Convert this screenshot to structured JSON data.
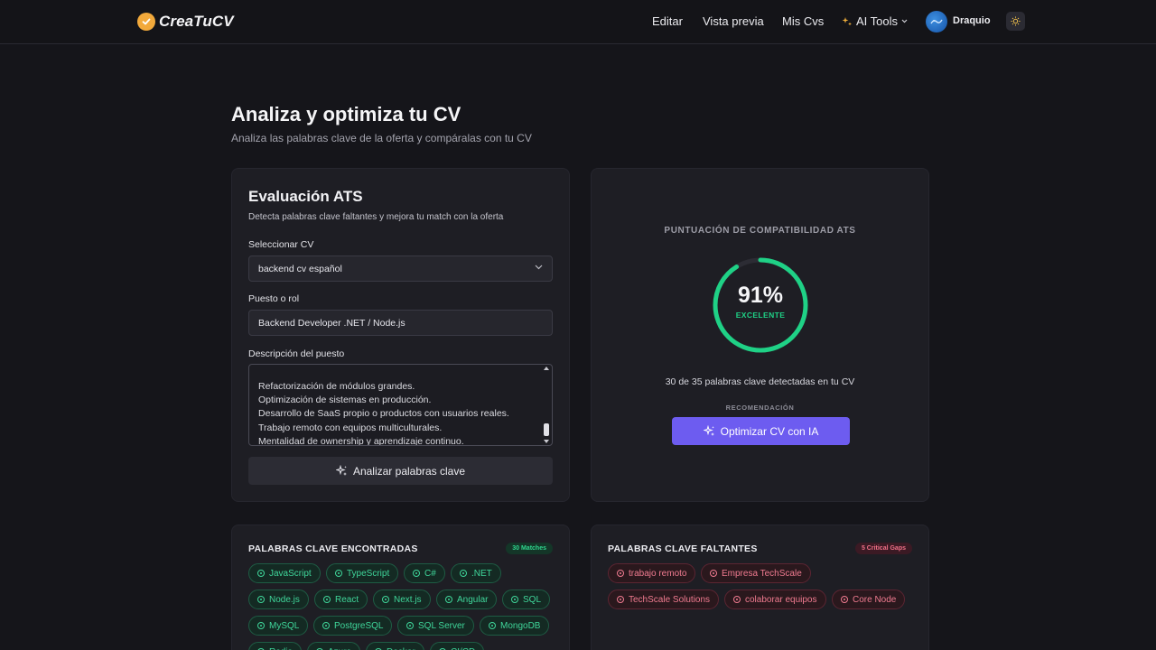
{
  "nav": {
    "logo": "CreaTuCV",
    "links": [
      "Editar",
      "Vista previa",
      "Mis Cvs"
    ],
    "ai_tools": "AI Tools",
    "user": "Draquio"
  },
  "header": {
    "title": "Analiza y optimiza tu CV",
    "subtitle": "Analiza las palabras clave de la oferta y compáralas con tu CV"
  },
  "evaluation": {
    "title": "Evaluación ATS",
    "subtitle": "Detecta palabras clave faltantes y mejora tu match con la oferta",
    "select_label": "Seleccionar CV",
    "select_value": "backend cv español",
    "role_label": "Puesto o rol",
    "role_value": "Backend Developer .NET / Node.js",
    "description_label": "Descripción del puesto",
    "description_lines": [
      "Refactorización de módulos grandes.",
      "Optimización de sistemas en producción.",
      "Desarrollo de SaaS propio o productos con usuarios reales.",
      "Trabajo remoto con equipos multiculturales.",
      "Mentalidad de ownership y aprendizaje continuo."
    ],
    "analyze_button": "Analizar palabras clave"
  },
  "score": {
    "heading": "PUNTUACIÓN DE COMPATIBILIDAD ATS",
    "value": "91%",
    "percent": 91,
    "label": "EXCELENTE",
    "detected": "30 de 35 palabras clave detectadas en tu CV",
    "recommendation_label": "RECOMENDACIÓN",
    "optimize_button": "Optimizar CV con IA",
    "accent_color": "#1fd186"
  },
  "found": {
    "title": "PALABRAS CLAVE ENCONTRADAS",
    "badge": "30 Matches",
    "chips": [
      "JavaScript",
      "TypeScript",
      "C#",
      ".NET",
      "Node.js",
      "React",
      "Next.js",
      "Angular",
      "SQL",
      "MySQL",
      "PostgreSQL",
      "SQL Server",
      "MongoDB",
      "Redis",
      "Azure",
      "Docker",
      "CI/CD"
    ]
  },
  "missing": {
    "title": "PALABRAS CLAVE FALTANTES",
    "badge": "5 Critical Gaps",
    "chips": [
      "trabajo remoto",
      "Empresa TechScale",
      "TechScale Solutions",
      "colaborar equipos",
      "Core Node"
    ]
  }
}
